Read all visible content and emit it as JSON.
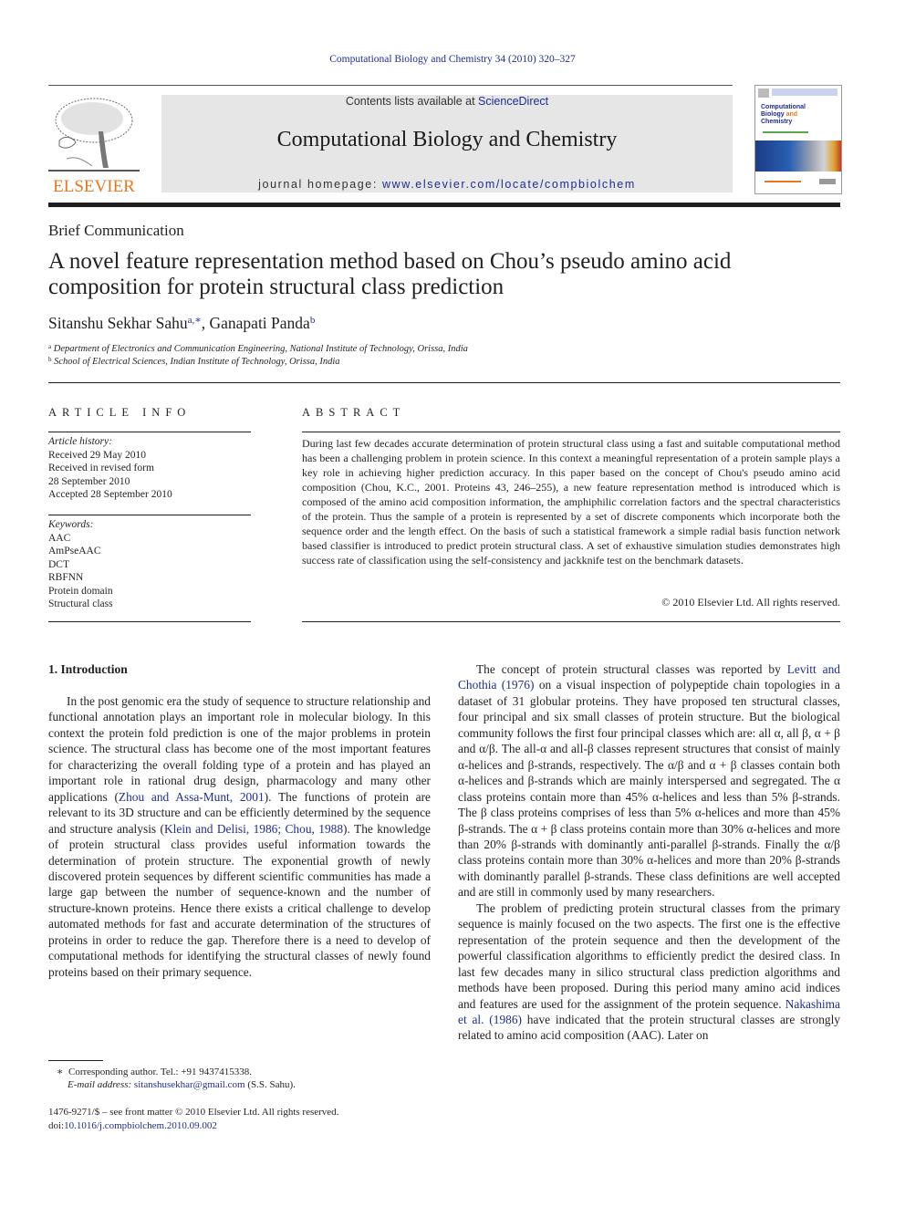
{
  "running_head": "Computational Biology and Chemistry 34 (2010) 320–327",
  "masthead": {
    "publisher_logo": "ELSEVIER",
    "contents_prefix": "Contents lists available at ",
    "contents_link": "ScienceDirect",
    "journal_title": "Computational Biology and Chemistry",
    "homepage_prefix": "journal homepage: ",
    "homepage_url": "www.elsevier.com/locate/compbiolchem",
    "cover": {
      "title_line1": "Computational",
      "title_line2a": "Biology ",
      "title_line2b": "and",
      "title_line3": "Chemistry"
    }
  },
  "article": {
    "type": "Brief Communication",
    "title_line1": "A novel feature representation method based on Chou’s pseudo amino acid",
    "title_line2": "composition for protein structural class prediction",
    "authors": [
      {
        "name": "Sitanshu Sekhar Sahu",
        "sup": "a,∗"
      },
      {
        "name": "Ganapati Panda",
        "sup": "b"
      }
    ],
    "author_separator": ", ",
    "affiliations": [
      {
        "mark": "a",
        "text": "Department of Electronics and Communication Engineering, National Institute of Technology, Orissa, India"
      },
      {
        "mark": "b",
        "text": "School of Electrical Sciences, Indian Institute of Technology, Orissa, India"
      }
    ]
  },
  "article_info": {
    "heading": "ARTICLE INFO",
    "history_label": "Article history:",
    "history": [
      "Received 29 May 2010",
      "Received in revised form",
      "28 September 2010",
      "Accepted 28 September 2010"
    ],
    "keywords_label": "Keywords:",
    "keywords": [
      "AAC",
      "AmPseAAC",
      "DCT",
      "RBFNN",
      "Protein domain",
      "Structural class"
    ]
  },
  "abstract": {
    "heading": "ABSTRACT",
    "text": "During last few decades accurate determination of protein structural class using a fast and suitable computational method has been a challenging problem in protein science. In this context a meaningful representation of a protein sample plays a key role in achieving higher prediction accuracy. In this paper based on the concept of Chou's pseudo amino acid composition (Chou, K.C., 2001. Proteins 43, 246–255), a new feature representation method is introduced which is composed of the amino acid composition information, the amphiphilic correlation factors and the spectral characteristics of the protein. Thus the sample of a protein is represented by a set of discrete components which incorporate both the sequence order and the length effect. On the basis of such a statistical framework a simple radial basis function network based classifier is introduced to predict protein structural class. A set of exhaustive simulation studies demonstrates high success rate of classification using the self-consistency and jackknife test on the benchmark datasets.",
    "copyright": "© 2010 Elsevier Ltd. All rights reserved."
  },
  "introduction": {
    "heading": "1.  Introduction",
    "left_p1": {
      "t1": "In the post genomic era the study of sequence to structure relationship and functional annotation plays an important role in molecular biology. In this context the protein fold prediction is one of the major problems in protein science. The structural class has become one of the most important features for characterizing the overall folding type of a protein and has played an important role in rational drug design, pharmacology and many other applications (",
      "c1": "Zhou and Assa-Munt, 2001",
      "t2": "). The functions of protein are relevant to its 3D structure and can be efficiently determined by the sequence and structure analysis (",
      "c2": "Klein and Delisi, 1986; Chou, 1988",
      "t3": "). The knowledge of protein structural class provides useful information towards the determination of protein structure. The exponential growth of newly discovered protein sequences by different scientific communities has made a large gap between the number of sequence-known and the number of structure-known proteins. Hence there exists a critical challenge to develop automated methods for fast and accurate determination of the structures of proteins in order to reduce the gap. Therefore there is a need to develop of computational methods for identifying the structural classes of newly found proteins based on their primary sequence."
    },
    "right_p1": {
      "t1": "The concept of protein structural classes was reported by ",
      "c1": "Levitt and Chothia (1976)",
      "t2": " on a visual inspection of polypeptide chain topologies in a dataset of 31 globular proteins. They have proposed ten structural classes, four principal and six small classes of protein structure. But the biological community follows the first four principal classes which are: all α, all β, α + β and α/β. The all-α and all-β classes represent structures that consist of mainly α-helices and β-strands, respectively. The α/β and α + β classes contain both α-helices and β-strands which are mainly interspersed and segregated. The α class proteins contain more than 45% α-helices and less than 5% β-strands. The β class proteins comprises of less than 5% α-helices and more than 45% β-strands. The α + β class proteins contain more than 30% α-helices and more than 20% β-strands with dominantly anti-parallel β-strands. Finally the α/β class proteins contain more than 30% α-helices and more than 20% β-strands with dominantly parallel β-strands. These class definitions are well accepted and are still in commonly used by many researchers."
    },
    "right_p2": {
      "t1": "The problem of predicting protein structural classes from the primary sequence is mainly focused on the two aspects. The first one is the effective representation of the protein sequence and then the development of the powerful classification algorithms to efficiently predict the desired class. In last few decades many in silico structural class prediction algorithms and methods have been proposed. During this period many amino acid indices and features are used for the assignment of the protein sequence. ",
      "c1": "Nakashima et al. (1986)",
      "t2": " have indicated that the protein structural classes are strongly related to amino acid composition (AAC). Later on"
    }
  },
  "footnote": {
    "mark": "∗",
    "corresponding": "Corresponding author. Tel.: +91 9437415338.",
    "email_label": "E-mail address: ",
    "email": "sitanshusekhar@gmail.com",
    "email_suffix": " (S.S. Sahu)."
  },
  "footer": {
    "issn_line": "1476-9271/$ – see front matter © 2010 Elsevier Ltd. All rights reserved.",
    "doi_prefix": "doi:",
    "doi": "10.1016/j.compbiolchem.2010.09.002"
  },
  "colors": {
    "link": "#1f2d8f",
    "elsevier_orange": "#e8771e",
    "banner_bg": "#e6e6e6",
    "text": "#231f20"
  }
}
